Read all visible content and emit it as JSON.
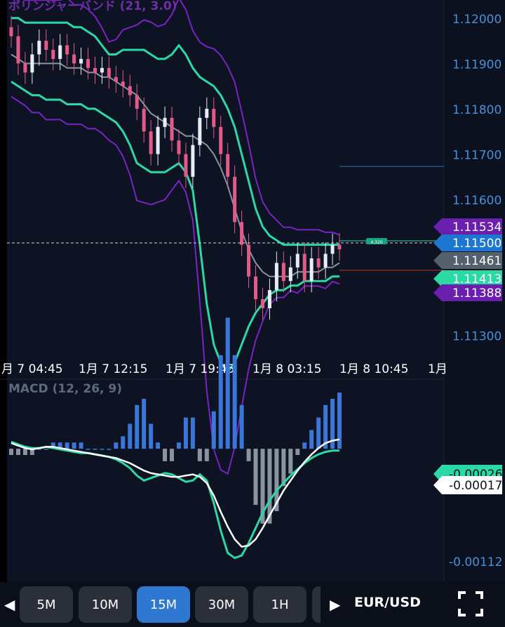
{
  "chart_data": [
    {
      "type": "candlestick",
      "indicator_label": "ボリンジャーバンド (21, 3.0)",
      "ylim": [
        1.1125,
        1.1204
      ],
      "y_ticks": [
        "1.12000",
        "1.11900",
        "1.11800",
        "1.11700",
        "1.11600",
        "1.11300"
      ],
      "x_ticks": [
        "月 7 04:45",
        "1月 7 12:15",
        "1月 7 19:45",
        "1月 8 03:15",
        "1月 8 10:45",
        "1月"
      ],
      "price_badges": [
        {
          "text": "1.11534",
          "color": "#6a1fae"
        },
        {
          "text": "1.11500",
          "color": "#1d76cf"
        },
        {
          "text": "1.11461",
          "color": "#55606d"
        },
        {
          "text": "1.11413",
          "color": "#2bd9a4"
        },
        {
          "text": "1.11388",
          "color": "#6a1fae"
        }
      ],
      "order_tag": "4,320",
      "series": [
        {
          "name": "close",
          "values": [
            1.1196,
            1.119,
            1.1188,
            1.1192,
            1.1195,
            1.1193,
            1.1191,
            1.1194,
            1.1192,
            1.119,
            1.1191,
            1.1189,
            1.1188,
            1.1189,
            1.1187,
            1.1186,
            1.1185,
            1.1183,
            1.118,
            1.1175,
            1.117,
            1.1176,
            1.1178,
            1.1173,
            1.117,
            1.1165,
            1.1172,
            1.1178,
            1.118,
            1.1176,
            1.117,
            1.1165,
            1.1155,
            1.115,
            1.1143,
            1.1138,
            1.1136,
            1.114,
            1.1146,
            1.1142,
            1.1145,
            1.1148,
            1.1142,
            1.1147,
            1.1145,
            1.1148,
            1.115,
            1.1149
          ]
        },
        {
          "name": "bb_mid",
          "values": [
            1.1192,
            1.1191,
            1.119,
            1.119,
            1.119,
            1.119,
            1.119,
            1.119,
            1.1189,
            1.1189,
            1.1189,
            1.1188,
            1.1188,
            1.1187,
            1.1187,
            1.1186,
            1.1185,
            1.1184,
            1.1183,
            1.1181,
            1.1179,
            1.1178,
            1.1177,
            1.1176,
            1.1175,
            1.1174,
            1.1174,
            1.1173,
            1.1172,
            1.117,
            1.1167,
            1.1163,
            1.1158,
            1.1153,
            1.1149,
            1.1146,
            1.1144,
            1.1143,
            1.1143,
            1.1143,
            1.1143,
            1.1144,
            1.1144,
            1.1144,
            1.1144,
            1.1145,
            1.1145,
            1.1146
          ]
        },
        {
          "name": "bb_upper",
          "values": [
            1.12,
            1.12,
            1.1199,
            1.1199,
            1.1199,
            1.1199,
            1.1199,
            1.1199,
            1.1199,
            1.1198,
            1.1198,
            1.1197,
            1.1196,
            1.1194,
            1.1192,
            1.1192,
            1.1193,
            1.1193,
            1.1193,
            1.1193,
            1.1192,
            1.1191,
            1.1191,
            1.1192,
            1.1194,
            1.1192,
            1.1189,
            1.1187,
            1.1186,
            1.1185,
            1.1183,
            1.118,
            1.1176,
            1.117,
            1.1164,
            1.1158,
            1.1154,
            1.1152,
            1.1151,
            1.115,
            1.115,
            1.115,
            1.115,
            1.115,
            1.115,
            1.115,
            1.115,
            1.115
          ]
        },
        {
          "name": "bb_lower",
          "values": [
            1.1186,
            1.1185,
            1.1184,
            1.1183,
            1.1183,
            1.1182,
            1.1182,
            1.1182,
            1.1181,
            1.1181,
            1.1181,
            1.118,
            1.118,
            1.1179,
            1.1178,
            1.1177,
            1.1175,
            1.1172,
            1.1168,
            1.1167,
            1.1166,
            1.1166,
            1.1166,
            1.1167,
            1.1168,
            1.1166,
            1.1162,
            1.115,
            1.1137,
            1.1128,
            1.1124,
            1.1122,
            1.1124,
            1.1128,
            1.1132,
            1.1135,
            1.1137,
            1.1139,
            1.114,
            1.114,
            1.1141,
            1.1141,
            1.1142,
            1.1142,
            1.1142,
            1.1142,
            1.1143,
            1.1143
          ]
        }
      ]
    },
    {
      "type": "macd",
      "indicator_label": "MACD (12, 26, 9)",
      "y_ticks": [
        "-0.00112"
      ],
      "value_badges": [
        {
          "text": "-0.00026",
          "color": "#2bd9a4"
        },
        {
          "text": "-0.00017",
          "color": "#ffffff"
        }
      ],
      "series": [
        {
          "name": "macd",
          "values": [
            -0.0002,
            -0.00022,
            -0.00024,
            -0.00025,
            -0.00024,
            -0.00023,
            -0.00023,
            -0.00024,
            -0.00025,
            -0.00026,
            -0.00027,
            -0.00028,
            -0.00029,
            -0.0003,
            -0.00031,
            -0.00032,
            -0.00034,
            -0.00036,
            -0.00039,
            -0.00042,
            -0.00044,
            -0.00045,
            -0.00046,
            -0.00047,
            -0.00047,
            -0.00046,
            -0.00045,
            -0.00047,
            -0.00052,
            -0.00062,
            -0.00075,
            -0.00087,
            -0.00097,
            -0.00103,
            -0.00102,
            -0.00097,
            -0.00088,
            -0.00078,
            -0.00068,
            -0.00058,
            -0.0005,
            -0.00042,
            -0.00035,
            -0.00029,
            -0.00024,
            -0.0002,
            -0.00018,
            -0.00017
          ]
        },
        {
          "name": "signal",
          "values": [
            -0.00019,
            -0.00021,
            -0.00023,
            -0.00024,
            -0.00024,
            -0.00023,
            -0.00024,
            -0.00025,
            -0.00026,
            -0.00027,
            -0.00028,
            -0.00028,
            -0.00029,
            -0.0003,
            -0.00031,
            -0.00033,
            -0.00036,
            -0.0004,
            -0.00046,
            -0.0005,
            -0.00048,
            -0.00046,
            -0.00044,
            -0.00045,
            -0.00048,
            -0.00051,
            -0.0005,
            -0.00045,
            -0.0005,
            -0.00068,
            -0.0009,
            -0.00108,
            -0.00112,
            -0.0011,
            -0.001,
            -0.00088,
            -0.00076,
            -0.00066,
            -0.00058,
            -0.00052,
            -0.00046,
            -0.00041,
            -0.00036,
            -0.00032,
            -0.00029,
            -0.00027,
            -0.00026,
            -0.00026
          ]
        }
      ]
    }
  ],
  "timeframe_buttons": [
    "5M",
    "10M",
    "15M",
    "30M",
    "1H"
  ],
  "active_timeframe": "15M",
  "pair": "EUR/USD",
  "colors": {
    "background": "#0d1322",
    "bb_band": "#2bd9a4",
    "bb_outer": "#7a22c4",
    "bb_mid": "#8a94a0",
    "candle_up": "#e8ecf4",
    "candle_down": "#e45a87",
    "axis_text": "#4a90d9",
    "active_button": "#2e78d2"
  }
}
